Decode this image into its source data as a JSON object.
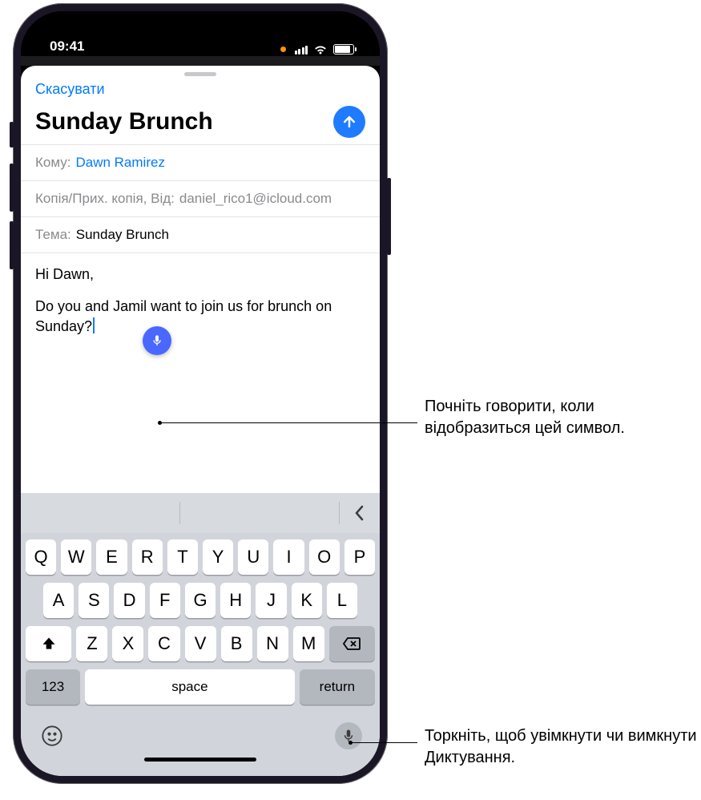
{
  "status_bar": {
    "time": "09:41"
  },
  "compose": {
    "cancel": "Скасувати",
    "title": "Sunday Brunch",
    "to_label": "Кому:",
    "to_value": "Dawn Ramirez",
    "cc_label": "Копія/Прих. копія, Від:",
    "cc_value": "daniel_rico1@icloud.com",
    "subject_label": "Тема:",
    "subject_value": "Sunday Brunch",
    "body_line1": "Hi Dawn,",
    "body_line2": "Do you and Jamil want to join us for brunch on Sunday?"
  },
  "keyboard": {
    "row1": [
      "Q",
      "W",
      "E",
      "R",
      "T",
      "Y",
      "U",
      "I",
      "O",
      "P"
    ],
    "row2": [
      "A",
      "S",
      "D",
      "F",
      "G",
      "H",
      "J",
      "K",
      "L"
    ],
    "row3": [
      "Z",
      "X",
      "C",
      "V",
      "B",
      "N",
      "M"
    ],
    "numbers": "123",
    "space": "space",
    "return": "return"
  },
  "callouts": {
    "dictation_indicator": "Почніть говорити, коли відобразиться цей символ.",
    "dictation_toggle": "Торкніть, щоб увімкнути чи вимкнути Диктування."
  }
}
